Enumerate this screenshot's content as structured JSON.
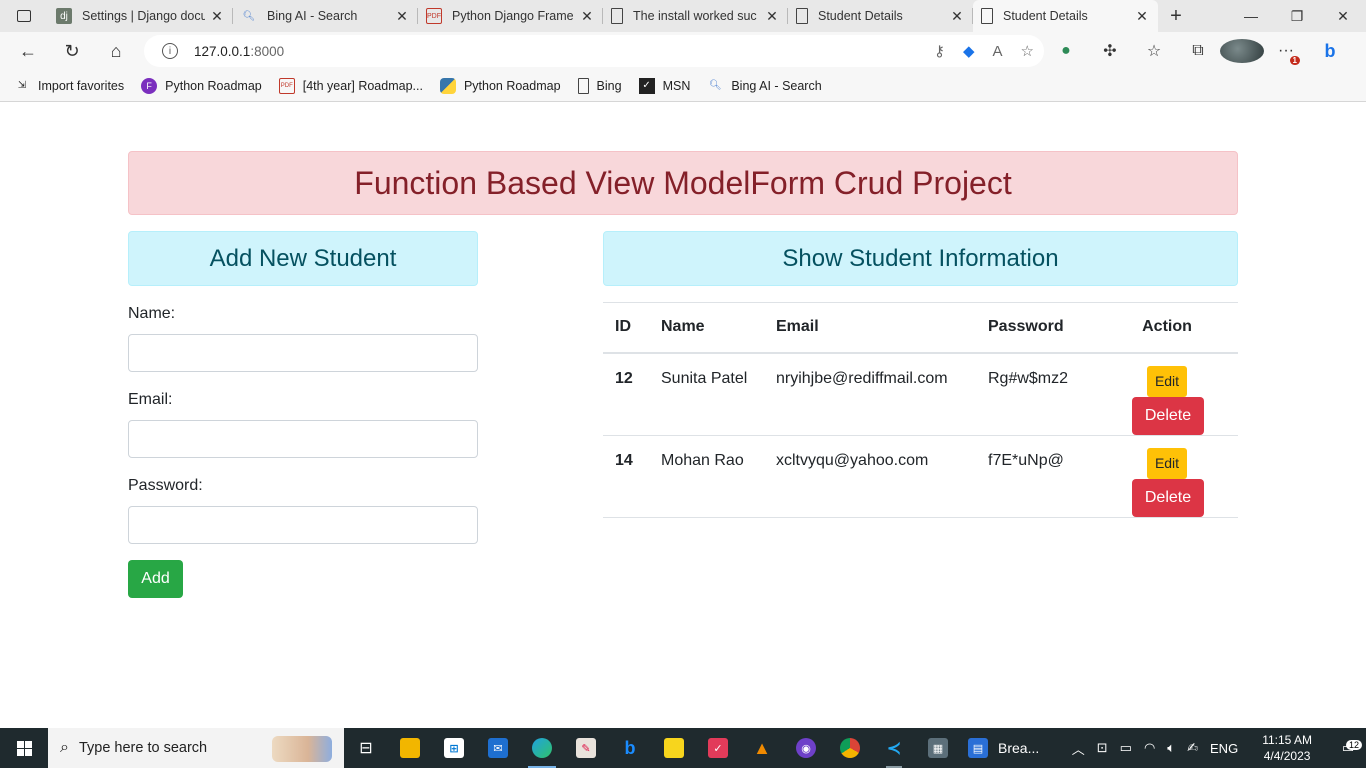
{
  "browser": {
    "tabs": [
      {
        "title": "Settings | Django docu",
        "favicon": "django-icon"
      },
      {
        "title": "Bing AI - Search",
        "favicon": "search-icon"
      },
      {
        "title": "Python Django Frame",
        "favicon": "pdf-icon"
      },
      {
        "title": "The install worked suc",
        "favicon": "page-icon"
      },
      {
        "title": "Student Details",
        "favicon": "page-icon"
      },
      {
        "title": "Student Details",
        "favicon": "page-icon",
        "active": true
      }
    ],
    "url_host": "127.0.0.1",
    "url_port": ":8000",
    "favorites": [
      {
        "label": "Import favorites",
        "icon": "import-icon"
      },
      {
        "label": "Python Roadmap",
        "icon": "purple-diamond-icon"
      },
      {
        "label": "[4th year] Roadmap...",
        "icon": "pdf-icon"
      },
      {
        "label": "Python Roadmap",
        "icon": "python-icon"
      },
      {
        "label": "Bing",
        "icon": "page-icon"
      },
      {
        "label": "MSN",
        "icon": "msn-icon"
      },
      {
        "label": "Bing AI - Search",
        "icon": "search-icon"
      }
    ],
    "notification_count": "1"
  },
  "page": {
    "banner_title": "Function Based View ModelForm Crud Project",
    "form": {
      "heading": "Add New Student",
      "name_label": "Name:",
      "email_label": "Email:",
      "password_label": "Password:",
      "name_value": "",
      "email_value": "",
      "password_value": "",
      "submit_label": "Add"
    },
    "table": {
      "heading": "Show Student Information",
      "columns": [
        "ID",
        "Name",
        "Email",
        "Password",
        "Action"
      ],
      "rows": [
        {
          "id": "12",
          "name": "Sunita Patel",
          "email": "nryihjbe@rediffmail.com",
          "password": "Rg#w$mz2",
          "edit": "Edit",
          "delete": "Delete"
        },
        {
          "id": "14",
          "name": "Mohan Rao",
          "email": "xcltvyqu@yahoo.com",
          "password": "f7E*uNp@",
          "edit": "Edit",
          "delete": "Delete"
        }
      ]
    }
  },
  "taskbar": {
    "search_placeholder": "Type here to search",
    "running_task": "Brea...",
    "language": "ENG",
    "time": "11:15 AM",
    "date": "4/4/2023",
    "notifications": "12"
  },
  "colors": {
    "banner_bg": "#f8d7da",
    "banner_text": "#842029",
    "info_bg": "#cff4fc",
    "info_text": "#055160",
    "add_button": "#28a745",
    "edit_button": "#ffc107",
    "delete_button": "#dc3545"
  }
}
